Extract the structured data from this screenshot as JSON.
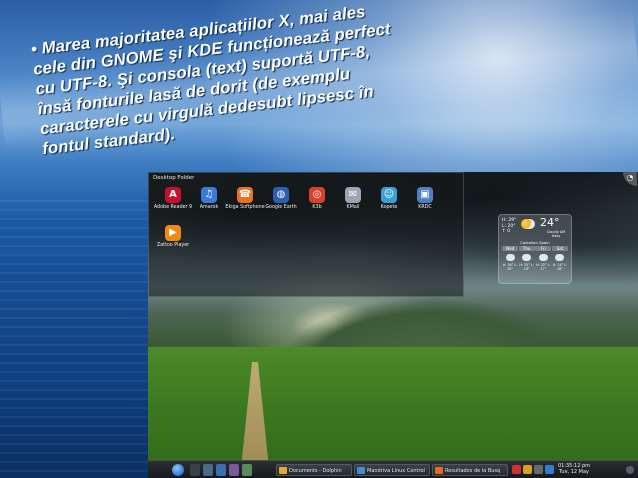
{
  "slide": {
    "bullet_lines": [
      "• Marea majoritatea aplicațiilor X, mai ales",
      "cele din GNOME şi KDE funcționează perfect",
      "cu UTF-8. Şi consola (text) suportă UTF-8,",
      "însă fonturile lasă de dorit (de exemplu",
      "caracterele cu virgulă dedesubt lipsesc în",
      "fontul standard)."
    ]
  },
  "desktop": {
    "folder_view_title": "Desktop Folder",
    "icons": [
      {
        "label": "Adobe Reader 9",
        "icon": "adobe-reader-icon",
        "color": "#c8102e",
        "glyph": "A"
      },
      {
        "label": "Amarok",
        "icon": "amarok-icon",
        "color": "#3a7bd5",
        "glyph": "♫"
      },
      {
        "label": "Ekiga Softphone",
        "icon": "ekiga-icon",
        "color": "#e8731a",
        "glyph": "☎"
      },
      {
        "label": "Google Earth",
        "icon": "google-earth-icon",
        "color": "#2c5fb3",
        "glyph": "◍"
      },
      {
        "label": "K3b",
        "icon": "k3b-icon",
        "color": "#d9412b",
        "glyph": "◎"
      },
      {
        "label": "KMail",
        "icon": "kmail-icon",
        "color": "#9aa6b2",
        "glyph": "✉"
      },
      {
        "label": "Kopete",
        "icon": "kopete-icon",
        "color": "#3aa0d8",
        "glyph": "☺"
      },
      {
        "label": "KRDC",
        "icon": "krdc-icon",
        "color": "#4f7ec4",
        "glyph": "▣"
      },
      {
        "label": "Zattoo Player",
        "icon": "zattoo-icon",
        "color": "#f08a12",
        "glyph": "▶"
      }
    ],
    "weather": {
      "min": "H: 29°",
      "max": "L: 20°",
      "wind": "↑ 0",
      "current_temp": "24°",
      "condition": "Cloudy AM",
      "condition_detail": "Hazy",
      "location": "Castellon Spain",
      "days": [
        {
          "name": "Wed",
          "range": "H: 26° L: 20°"
        },
        {
          "name": "Thu",
          "range": "H: 25° L: 19°"
        },
        {
          "name": "Fri",
          "range": "H: 22° L: 17°"
        },
        {
          "name": "Sat",
          "range": "H: 24° L: 18°"
        }
      ]
    },
    "taskbar": {
      "tasks": [
        "Documents - Dolphin",
        "Mandriva Linux Control",
        "Resultados de la Busq"
      ],
      "clock_time": "01:35:12 pm",
      "clock_date": "Tue, 12 May"
    }
  }
}
